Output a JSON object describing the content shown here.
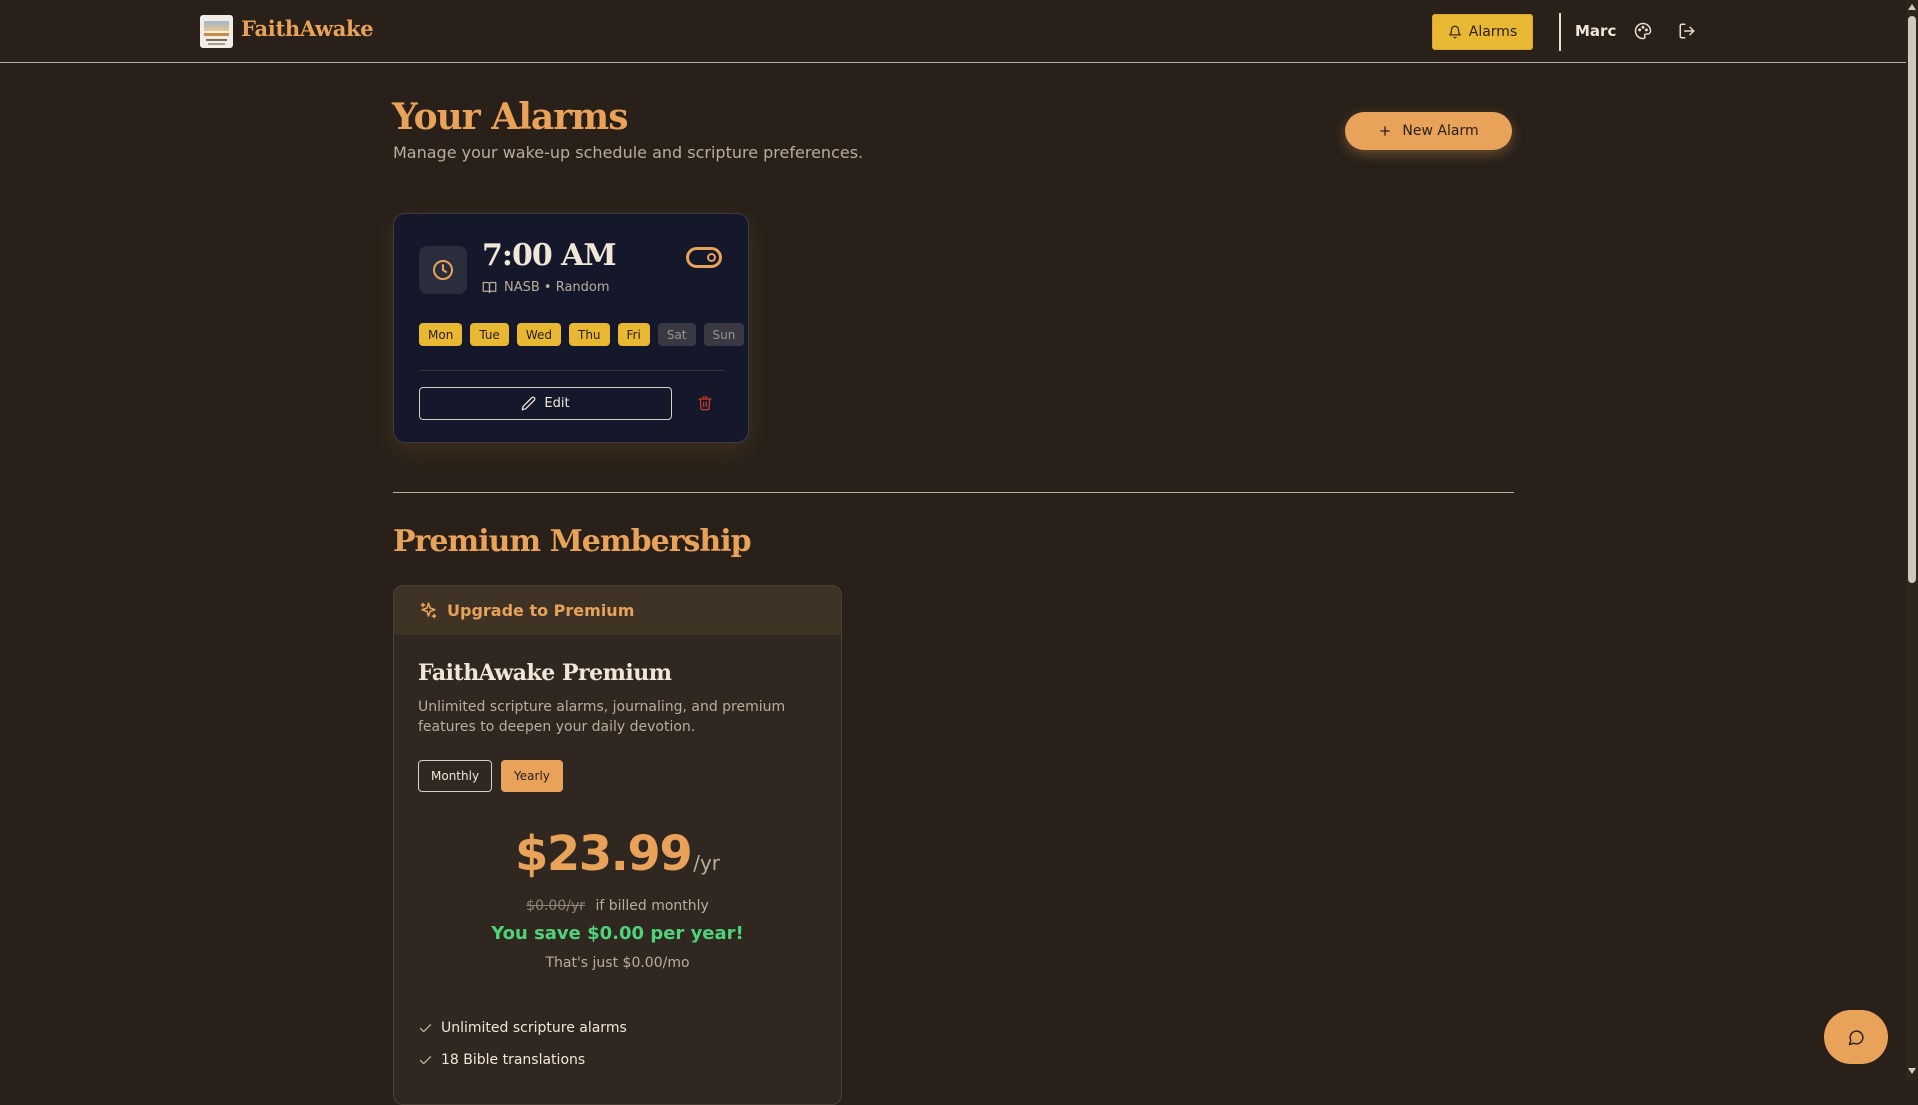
{
  "header": {
    "brand": "FaithAwake",
    "nav_alarms": "Alarms",
    "user_name": "Marc"
  },
  "page": {
    "title": "Your Alarms",
    "subtitle": "Manage your wake-up schedule and scripture preferences.",
    "new_alarm_label": "New Alarm"
  },
  "alarms": [
    {
      "time": "7:00 AM",
      "meta": "NASB • Random",
      "enabled": true,
      "days": [
        {
          "label": "Mon",
          "active": true
        },
        {
          "label": "Tue",
          "active": true
        },
        {
          "label": "Wed",
          "active": true
        },
        {
          "label": "Thu",
          "active": true
        },
        {
          "label": "Fri",
          "active": true
        },
        {
          "label": "Sat",
          "active": false
        },
        {
          "label": "Sun",
          "active": false
        }
      ],
      "edit_label": "Edit"
    }
  ],
  "premium": {
    "section_title": "Premium Membership",
    "card_header": "Upgrade to Premium",
    "plan_name": "FaithAwake Premium",
    "description": "Unlimited scripture alarms, journaling, and premium features to deepen your daily devotion.",
    "billing_monthly": "Monthly",
    "billing_yearly": "Yearly",
    "selected_billing": "Yearly",
    "price": "$23.99",
    "price_unit": "/yr",
    "compare_price": "$0.00/yr",
    "compare_text": "if billed monthly",
    "savings": "You save $0.00 per year!",
    "per_month": "That's just $0.00/mo",
    "features": [
      "Unlimited scripture alarms",
      "18 Bible translations"
    ]
  },
  "colors": {
    "background": "#282019",
    "accent": "#e8a25a",
    "gold": "#e9b833",
    "card": "#14182a",
    "success": "#4fd37a",
    "danger": "#c0392b"
  }
}
